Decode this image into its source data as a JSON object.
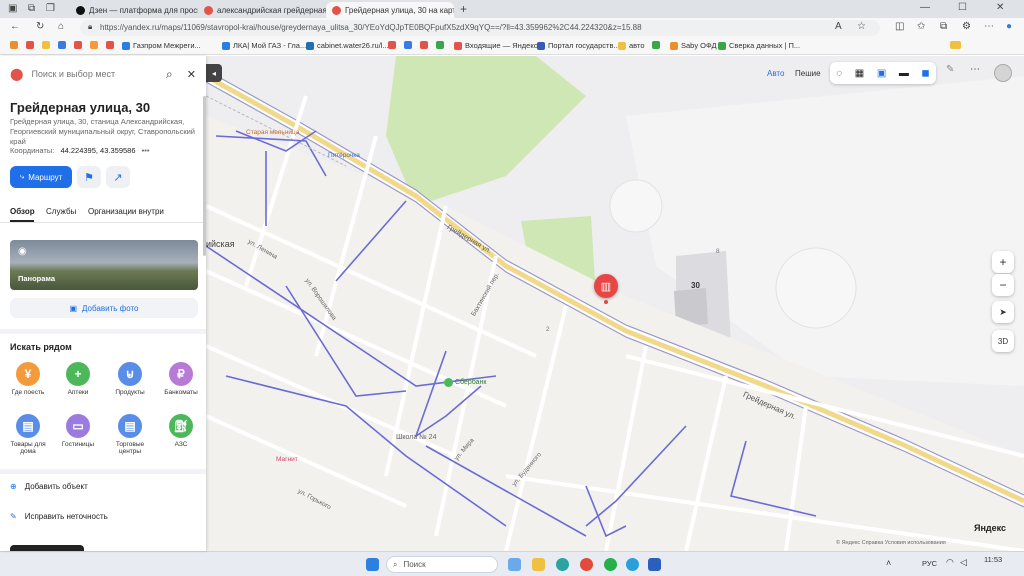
{
  "browser": {
    "tabs": [
      {
        "label": "Дзен — платформа для просмо",
        "color": "#111111"
      },
      {
        "label": "александрийская грейдерная 30",
        "color": "#e2534a"
      },
      {
        "label": "Грейдерная улица, 30 на карте",
        "color": "#e2534a"
      },
      {
        "label": "+",
        "color": ""
      }
    ],
    "url": "https://yandex.ru/maps/11069/stavropol-krai/house/greydernaya_ulitsa_30/YEoYdQJpTE0BQFpufX5zdX9qYQ==/?ll=43.359962%2C44.224320&z=15.88",
    "bookmarks": [
      {
        "label": "Газпром Межреги...",
        "color": "#2a7de1"
      },
      {
        "label": "ЛКА| Мой ГАЗ - Гла...",
        "color": "#2a7de1"
      },
      {
        "label": "cabinet.water26.ru/l...",
        "color": "#1f6fb5"
      },
      {
        "label": "Входящие — Яндекс...",
        "color": "#e2534a"
      },
      {
        "label": "Портал государств...",
        "color": "#3a5bb5"
      },
      {
        "label": "авто",
        "color": "#f0c040"
      },
      {
        "label": "Saby ОФД",
        "color": "#e89030"
      },
      {
        "label": "Сверка данных | П...",
        "color": "#3aa64a"
      }
    ]
  },
  "panel": {
    "search_placeholder": "Поиск и выбор мест",
    "title": "Грейдерная улица, 30",
    "address": "Грейдерная улица, 30, станица Александрийская, Георгиевский муниципальный округ, Ставропольский край",
    "coords_label": "Координаты:",
    "coords_value": "44.224395, 43.359586",
    "route_label": "Маршрут",
    "tabs": [
      "Обзор",
      "Службы",
      "Организации внутри"
    ],
    "panorama_label": "Панорама",
    "add_photo_label": "Добавить фото",
    "nearby_title": "Искать рядом",
    "categories": [
      {
        "label": "Где поесть",
        "color": "#f39a3b",
        "icon": "fork-icon"
      },
      {
        "label": "Аптеки",
        "color": "#4cb85a",
        "icon": "plus-icon"
      },
      {
        "label": "Продукты",
        "color": "#5a8de8",
        "icon": "basket-icon"
      },
      {
        "label": "Банкоматы",
        "color": "#b77bd6",
        "icon": "ruble-icon"
      },
      {
        "label": "Товары для дома",
        "color": "#5a8de8",
        "icon": "bag-icon"
      },
      {
        "label": "Гостиницы",
        "color": "#9b7be0",
        "icon": "bed-icon"
      },
      {
        "label": "Торговые центры",
        "color": "#5a8de8",
        "icon": "bag-icon"
      },
      {
        "label": "АЗС",
        "color": "#4cb85a",
        "icon": "fuel-icon"
      }
    ],
    "add_object_label": "Добавить объект",
    "fix_label": "Исправить неточность"
  },
  "map": {
    "mode_auto": "Авто",
    "mode_walk": "Пешие",
    "house_number": "30",
    "ctrl_3d": "3D",
    "logo": "Яндекс",
    "footer": "© Яндекс   Справка   Условия использования",
    "labels": {
      "greydernaya": "Грейдерная ул.",
      "school": "Школа № 24",
      "sberbank": "Сбербанк",
      "mechanic": "Старая мельница",
      "pyaterochka": "Пятёрочка",
      "magnit": "Магнит",
      "street_lenina": "ул. Ленина",
      "street_gorkogo": "ул. Горького",
      "street_budennogo": "ул. Буденного",
      "street_mira": "ул. Мира",
      "street_voroshilova": "ул. Ворошилова",
      "pereulok": "Бахтинский пер.",
      "alexandriyskaya": "ийская",
      "number_2": "2",
      "number_8": "8"
    }
  },
  "taskbar": {
    "search_label": "Поиск",
    "lang": "РУС",
    "time": "11:53"
  }
}
